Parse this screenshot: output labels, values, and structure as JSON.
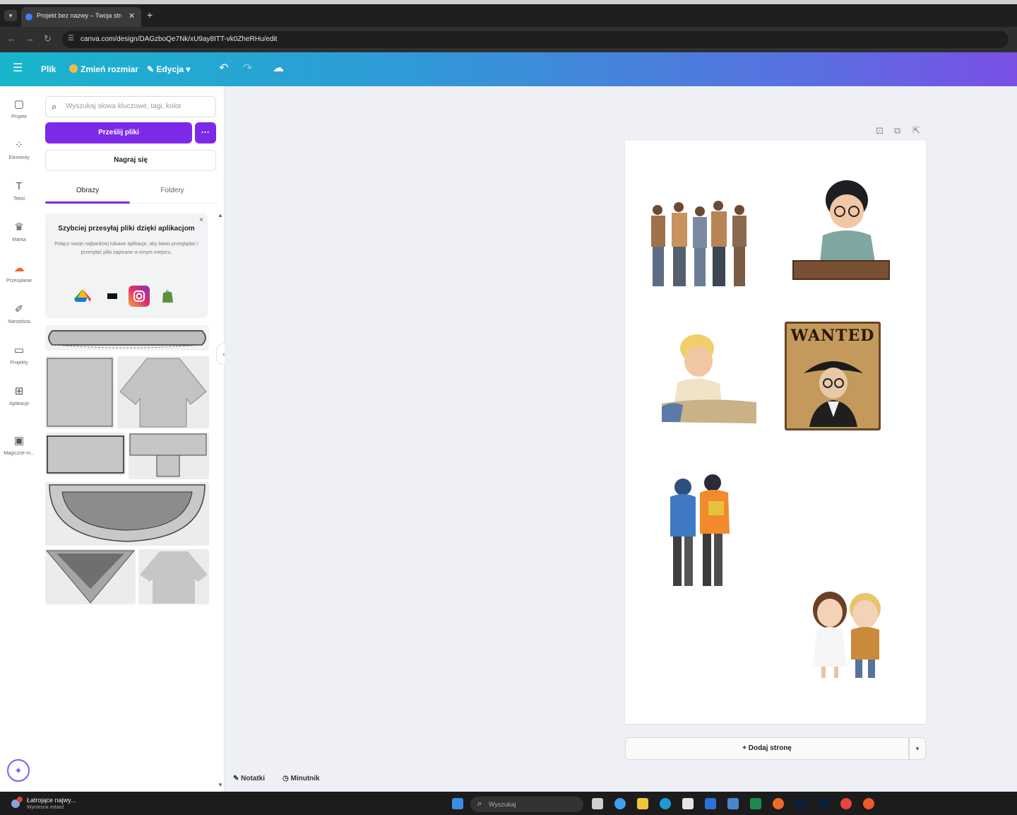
{
  "browser": {
    "tab_title": "Projekt bez nazwy – Twoja stro...",
    "url": "canva.com/design/DAGzboQe7Nk/xU9ay8ITT-vk0ZheRHu/edit"
  },
  "header": {
    "menu_icon": "hamburger-icon",
    "file_label": "Plik",
    "resize_label": "Zmień rozmiar",
    "edit_label": "Edycja",
    "undo_icon": "undo-icon",
    "redo_icon": "redo-icon",
    "cloud_icon": "cloud-save-icon"
  },
  "rail": {
    "items": [
      {
        "label": "Projekt",
        "icon": "template-icon"
      },
      {
        "label": "Elementy",
        "icon": "elements-icon"
      },
      {
        "label": "Tekst",
        "icon": "text-icon"
      },
      {
        "label": "Marka",
        "icon": "brand-icon"
      },
      {
        "label": "Przesyłanie",
        "icon": "upload-cloud-icon"
      },
      {
        "label": "Narzędzia",
        "icon": "draw-icon"
      },
      {
        "label": "Projekty",
        "icon": "folder-icon"
      },
      {
        "label": "Aplikacje",
        "icon": "apps-icon"
      },
      {
        "label": "Magiczne m...",
        "icon": "magic-media-icon"
      }
    ],
    "magic_icon": "magic-sparkle-icon"
  },
  "panel": {
    "search_placeholder": "Wyszukaj słowa kluczowe, tagi, kolor",
    "upload_label": "Prześlij pliki",
    "more_label": "···",
    "record_label": "Nagraj się",
    "tabs": [
      "Obrazy",
      "Foldery"
    ],
    "promo": {
      "title": "Szybciej przesyłaj pliki dzięki aplikacjom",
      "body": "Połącz swoje najbardziej lubiane aplikacje, aby łatwo przeglądać i przesyłać pliki zapisane w innym miejscu.",
      "close": "×",
      "apps": [
        "google-drive-icon",
        "dropbox-icon",
        "instagram-icon",
        "shopify-icon"
      ]
    }
  },
  "canvas": {
    "page_tool_icons": [
      "lock-icon",
      "duplicate-icon",
      "share-page-icon"
    ],
    "add_page_label": "+ Dodaj stronę",
    "bottom_tools": [
      {
        "label": "Notatki",
        "icon": "notes-icon"
      },
      {
        "label": "Minutnik",
        "icon": "timer-icon"
      }
    ],
    "elements": [
      "group-of-men",
      "boy-with-glasses-at-desk",
      "blond-boy-thinking",
      "wanted-poster",
      "two-teens-in-hoodies",
      "cartoon-couple"
    ],
    "wanted_text": "WANTED"
  },
  "taskbar": {
    "news_title": "Łatrojące najwy...",
    "news_sub": "Wyniesna mitard",
    "search_placeholder": "Wyszukaj"
  },
  "colors": {
    "accent": "#7d2ae8",
    "header_start": "#18b5cc",
    "header_end": "#7a4fe6"
  }
}
